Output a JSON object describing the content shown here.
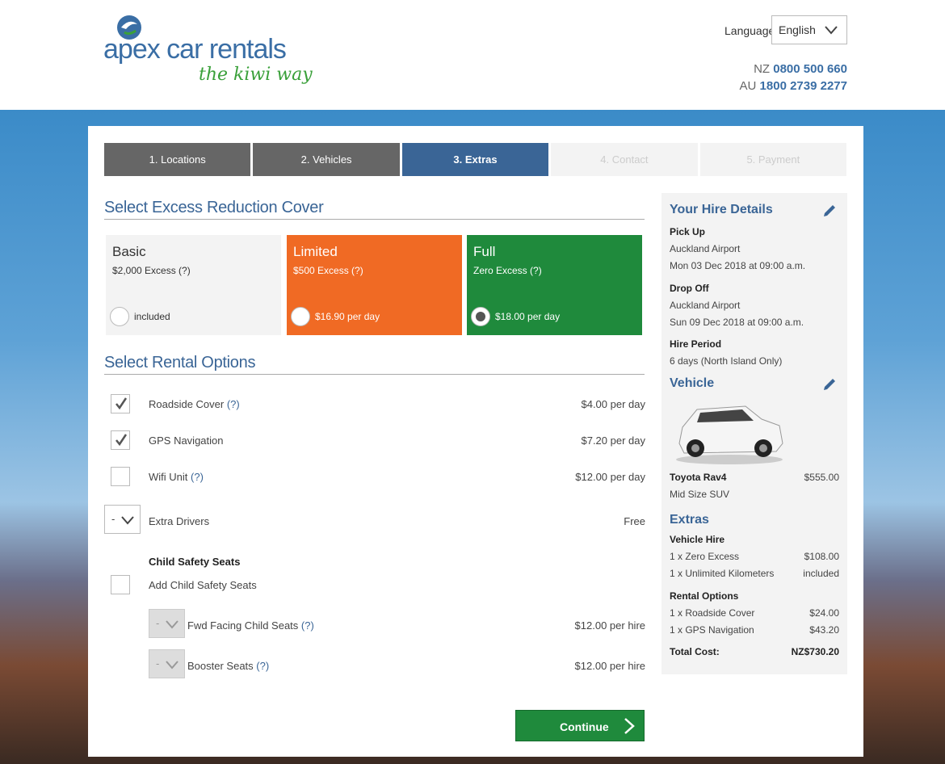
{
  "header": {
    "brand": "apex car rentals",
    "tagline": "the kiwi way",
    "language_label": "Language",
    "language_value": "English",
    "phone_nz_prefix": "NZ",
    "phone_nz": "0800 500 660",
    "phone_au_prefix": "AU",
    "phone_au": "1800 2739 2277"
  },
  "steps": [
    {
      "label": "1. Locations",
      "state": "done"
    },
    {
      "label": "2. Vehicles",
      "state": "done"
    },
    {
      "label": "3. Extras",
      "state": "active"
    },
    {
      "label": "4. Contact",
      "state": "todo"
    },
    {
      "label": "5. Payment",
      "state": "todo"
    }
  ],
  "excess": {
    "title": "Select Excess Reduction Cover",
    "options": [
      {
        "name": "Basic",
        "sub": "$2,000 Excess (?)",
        "price": "included",
        "selected": false
      },
      {
        "name": "Limited",
        "sub": "$500 Excess (?)",
        "price": "$16.90 per day",
        "selected": false
      },
      {
        "name": "Full",
        "sub": "Zero Excess (?)",
        "price": "$18.00 per day",
        "selected": true
      }
    ]
  },
  "rental_options": {
    "title": "Select Rental Options",
    "items": [
      {
        "label": "Roadside Cover",
        "help": "(?)",
        "price": "$4.00 per day",
        "checked": true
      },
      {
        "label": "GPS Navigation",
        "help": "",
        "price": "$7.20 per day",
        "checked": true
      },
      {
        "label": "Wifi Unit",
        "help": "(?)",
        "price": "$12.00 per day",
        "checked": false
      }
    ],
    "extra_drivers": {
      "value": "-",
      "label": "Extra Drivers",
      "price": "Free"
    },
    "child_seats": {
      "heading": "Child Safety Seats",
      "add_label": "Add Child Safety Seats",
      "fwd": {
        "value": "-",
        "label": "Fwd Facing Child Seats",
        "help": "(?)",
        "price": "$12.00 per hire"
      },
      "booster": {
        "value": "-",
        "label": "Booster Seats",
        "help": "(?)",
        "price": "$12.00 per hire"
      }
    },
    "continue_label": "Continue"
  },
  "summary": {
    "title": "Your Hire Details",
    "pickup_heading": "Pick Up",
    "pickup_location": "Auckland Airport",
    "pickup_time": "Mon 03 Dec 2018 at 09:00 a.m.",
    "dropoff_heading": "Drop Off",
    "dropoff_location": "Auckland Airport",
    "dropoff_time": "Sun 09 Dec 2018 at 09:00 a.m.",
    "period_heading": "Hire Period",
    "period_value": "6 days (North Island Only)",
    "vehicle_title": "Vehicle",
    "vehicle_name": "Toyota Rav4",
    "vehicle_price": "$555.00",
    "vehicle_class": "Mid Size SUV",
    "extras_title": "Extras",
    "vehicle_hire_heading": "Vehicle Hire",
    "vh_items": [
      {
        "label": "1 x Zero Excess",
        "value": "$108.00"
      },
      {
        "label": "1 x Unlimited Kilometers",
        "value": "included"
      }
    ],
    "rental_options_heading": "Rental Options",
    "ro_items": [
      {
        "label": "1 x Roadside Cover",
        "value": "$24.00"
      },
      {
        "label": "1 x GPS Navigation",
        "value": "$43.20"
      }
    ],
    "total_label": "Total Cost:",
    "total_value": "NZ$730.20"
  },
  "colors": {
    "brand_blue": "#3a6596",
    "green": "#1f8a3c",
    "orange": "#f06a24"
  }
}
